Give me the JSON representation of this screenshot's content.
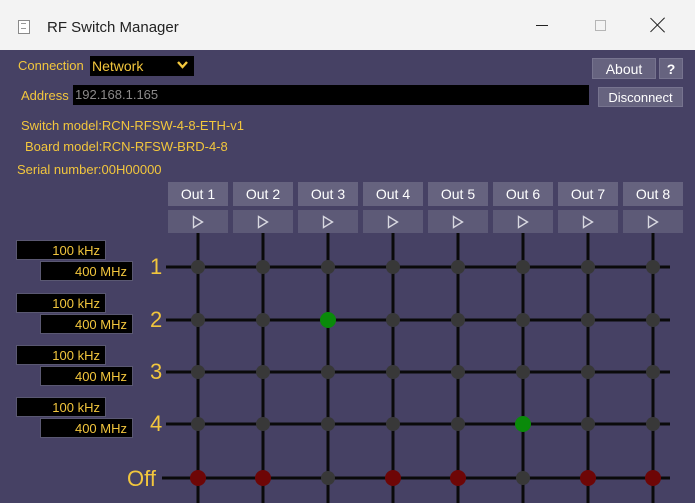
{
  "window": {
    "title": "RF Switch Manager"
  },
  "connection": {
    "label": "Connection",
    "value": "Network"
  },
  "toolbar": {
    "about_label": "About",
    "help_label": "?"
  },
  "address": {
    "label": "Address",
    "value": "192.168.1.165"
  },
  "disconnect_label": "Disconnect",
  "info": {
    "switch_model": "Switch model:RCN-RFSW-4-8-ETH-v1",
    "board_model": "Board model:RCN-RFSW-BRD-4-8",
    "serial_number": "Serial number:00H00000"
  },
  "outputs": [
    "Out 1",
    "Out 2",
    "Out 3",
    "Out 4",
    "Out 5",
    "Out 6",
    "Out 7",
    "Out 8"
  ],
  "rows": [
    {
      "label": "1",
      "freq_low": "100 kHz",
      "freq_high": "400 MHz"
    },
    {
      "label": "2",
      "freq_low": "100 kHz",
      "freq_high": "400 MHz"
    },
    {
      "label": "3",
      "freq_low": "100 kHz",
      "freq_high": "400 MHz"
    },
    {
      "label": "4",
      "freq_low": "100 kHz",
      "freq_high": "400 MHz"
    }
  ],
  "off_label": "Off",
  "active_connections": [
    {
      "row": "2",
      "output": "Out 3"
    },
    {
      "row": "4",
      "output": "Out 6"
    }
  ],
  "off_state": {
    "Out 1": true,
    "Out 2": true,
    "Out 3": false,
    "Out 4": true,
    "Out 5": true,
    "Out 6": false,
    "Out 7": true,
    "Out 8": true
  },
  "colors": {
    "background": "#464164",
    "accent_text": "#f2c63d",
    "node_inactive": "#383838",
    "node_connected": "#0a8a0a",
    "node_off": "#6e0606",
    "button": "#66637f"
  }
}
